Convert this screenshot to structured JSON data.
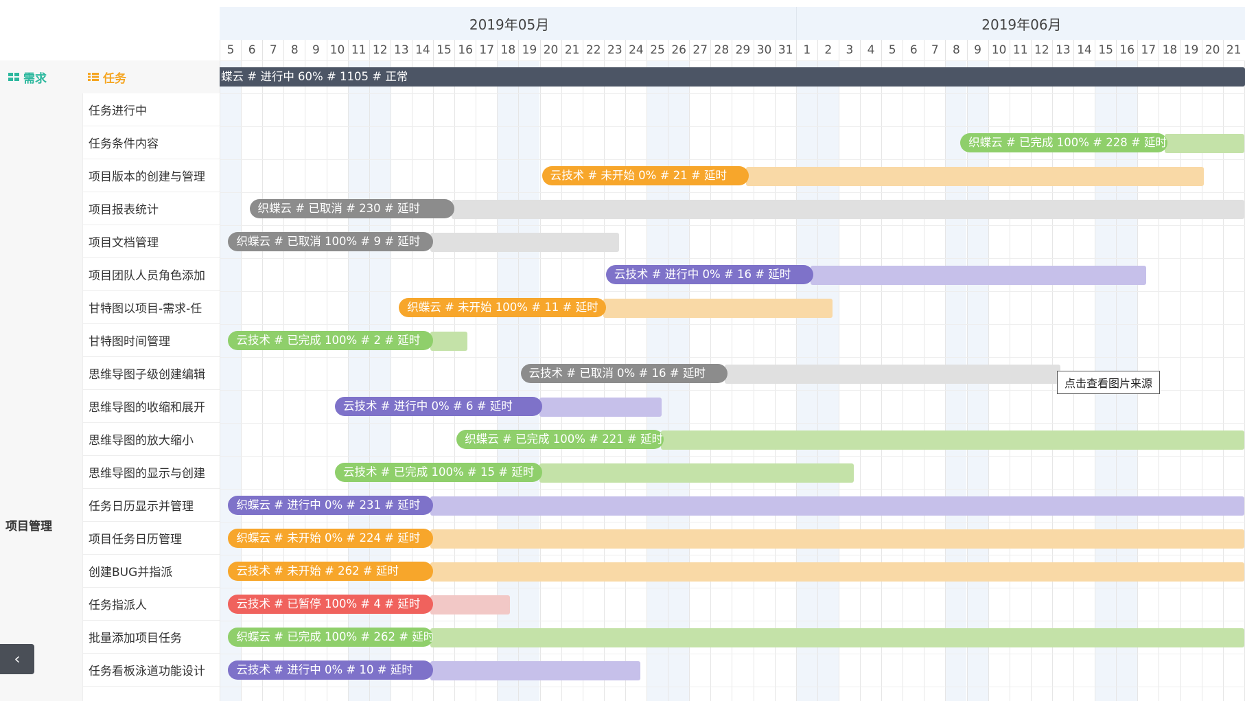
{
  "months": [
    {
      "label": "2019年05月",
      "start_index": 0,
      "span": 27
    },
    {
      "label": "2019年06月",
      "start_index": 27,
      "span": 21
    }
  ],
  "days": [
    "5",
    "6",
    "7",
    "8",
    "9",
    "10",
    "11",
    "12",
    "13",
    "14",
    "15",
    "16",
    "17",
    "18",
    "19",
    "20",
    "21",
    "22",
    "23",
    "24",
    "25",
    "26",
    "27",
    "28",
    "29",
    "30",
    "31",
    "1",
    "2",
    "3",
    "4",
    "5",
    "6",
    "7",
    "8",
    "9",
    "10",
    "11",
    "12",
    "13",
    "14",
    "15",
    "16",
    "17",
    "18",
    "19",
    "20",
    "21"
  ],
  "weekend_indices": [
    0,
    6,
    7,
    13,
    14,
    20,
    21,
    27,
    28,
    34,
    35,
    41,
    42
  ],
  "headers": {
    "requirement": "需求",
    "task": "任务"
  },
  "requirement_group": "项目管理",
  "colors": {
    "dark": "#4c5565",
    "gray": "#8c8c8c",
    "gray_bg": "#e0e0e0",
    "green": "#8fcf6b",
    "green_bg": "#c4e2a8",
    "orange": "#f7a62b",
    "orange_bg": "#f9d9a6",
    "purple": "#7e72c9",
    "purple_bg": "#c6c0ea",
    "red": "#f0625d",
    "red_bg": "#f2c8c6"
  },
  "summary": {
    "label": "蝶云 # 进行中 60% # 1105 # 正常",
    "color": "dark"
  },
  "tasks": [
    {
      "name": "任务进行中"
    },
    {
      "name": "任务条件内容",
      "bar": {
        "label": "织蝶云 # 已完成 100% # 228 # 延时",
        "color": "green",
        "start": 34.7,
        "label_end": 44.4,
        "end": 48
      }
    },
    {
      "name": "项目版本的创建与管理",
      "bar": {
        "label": "云技术 # 未开始 0% # 21 # 延时",
        "color": "orange",
        "start": 15.1,
        "label_end": 24.8,
        "end": 46.1
      }
    },
    {
      "name": "项目报表统计",
      "bar": {
        "label": "织蝶云 # 已取消 # 230 # 延时",
        "color": "gray",
        "start": 1.4,
        "label_end": 11.0,
        "end": 48
      }
    },
    {
      "name": "项目文档管理",
      "bar": {
        "label": "织蝶云 # 已取消 100% # 9 # 延时",
        "color": "gray",
        "start": 0.4,
        "label_end": 10.0,
        "end": 18.7
      }
    },
    {
      "name": "项目团队人员角色添加",
      "bar": {
        "label": "云技术 # 进行中 0% # 16 # 延时",
        "color": "purple",
        "start": 18.1,
        "label_end": 27.8,
        "end": 43.4
      }
    },
    {
      "name": "甘特图以项目-需求-任",
      "bar": {
        "label": "织蝶云 # 未开始 100% # 11 # 延时",
        "color": "orange",
        "start": 8.4,
        "label_end": 18.1,
        "end": 28.7
      }
    },
    {
      "name": "甘特图时间管理",
      "bar": {
        "label": "云技术 # 已完成 100% # 2 # 延时",
        "color": "green",
        "start": 0.4,
        "label_end": 10.0,
        "end": 11.6
      }
    },
    {
      "name": "思维导图子级创建编辑",
      "bar": {
        "label": "云技术 # 已取消 0% # 16 # 延时",
        "color": "gray",
        "start": 14.1,
        "label_end": 23.8,
        "end": 39.4
      }
    },
    {
      "name": "思维导图的收缩和展开",
      "bar": {
        "label": "云技术 # 进行中 0% # 6 # 延时",
        "color": "purple",
        "start": 5.4,
        "label_end": 15.1,
        "end": 20.7
      }
    },
    {
      "name": "思维导图的放大缩小",
      "bar": {
        "label": "织蝶云 # 已完成 100% # 221 # 延时",
        "color": "green",
        "start": 11.1,
        "label_end": 20.8,
        "end": 48
      }
    },
    {
      "name": "思维导图的显示与创建",
      "bar": {
        "label": "云技术 # 已完成 100% # 15 # 延时",
        "color": "green",
        "start": 5.4,
        "label_end": 15.1,
        "end": 29.7
      }
    },
    {
      "name": "任务日历显示并管理",
      "bar": {
        "label": "织蝶云 # 进行中 0% # 231 # 延时",
        "color": "purple",
        "start": 0.4,
        "label_end": 10.0,
        "end": 48
      }
    },
    {
      "name": "项目任务日历管理",
      "bar": {
        "label": "织蝶云 # 未开始 0% # 224 # 延时",
        "color": "orange",
        "start": 0.4,
        "label_end": 10.0,
        "end": 48
      }
    },
    {
      "name": "创建BUG并指派",
      "bar": {
        "label": "云技术 # 未开始 # 262 # 延时",
        "color": "orange",
        "start": 0.4,
        "label_end": 10.0,
        "end": 48
      }
    },
    {
      "name": "任务指派人",
      "bar": {
        "label": "云技术 # 已暂停 100% # 4 # 延时",
        "color": "red",
        "start": 0.4,
        "label_end": 10.0,
        "end": 13.6
      }
    },
    {
      "name": "批量添加项目任务",
      "bar": {
        "label": "织蝶云 # 已完成 100% # 262 # 延时",
        "color": "green",
        "start": 0.4,
        "label_end": 10.0,
        "end": 48
      }
    },
    {
      "name": "任务看板泳道功能设计",
      "bar": {
        "label": "云技术 # 进行中 0% # 10 # 延时",
        "color": "purple",
        "start": 0.4,
        "label_end": 10.0,
        "end": 19.7
      }
    }
  ],
  "tooltip": "点击查看图片来源",
  "collapse_glyph": "‹"
}
